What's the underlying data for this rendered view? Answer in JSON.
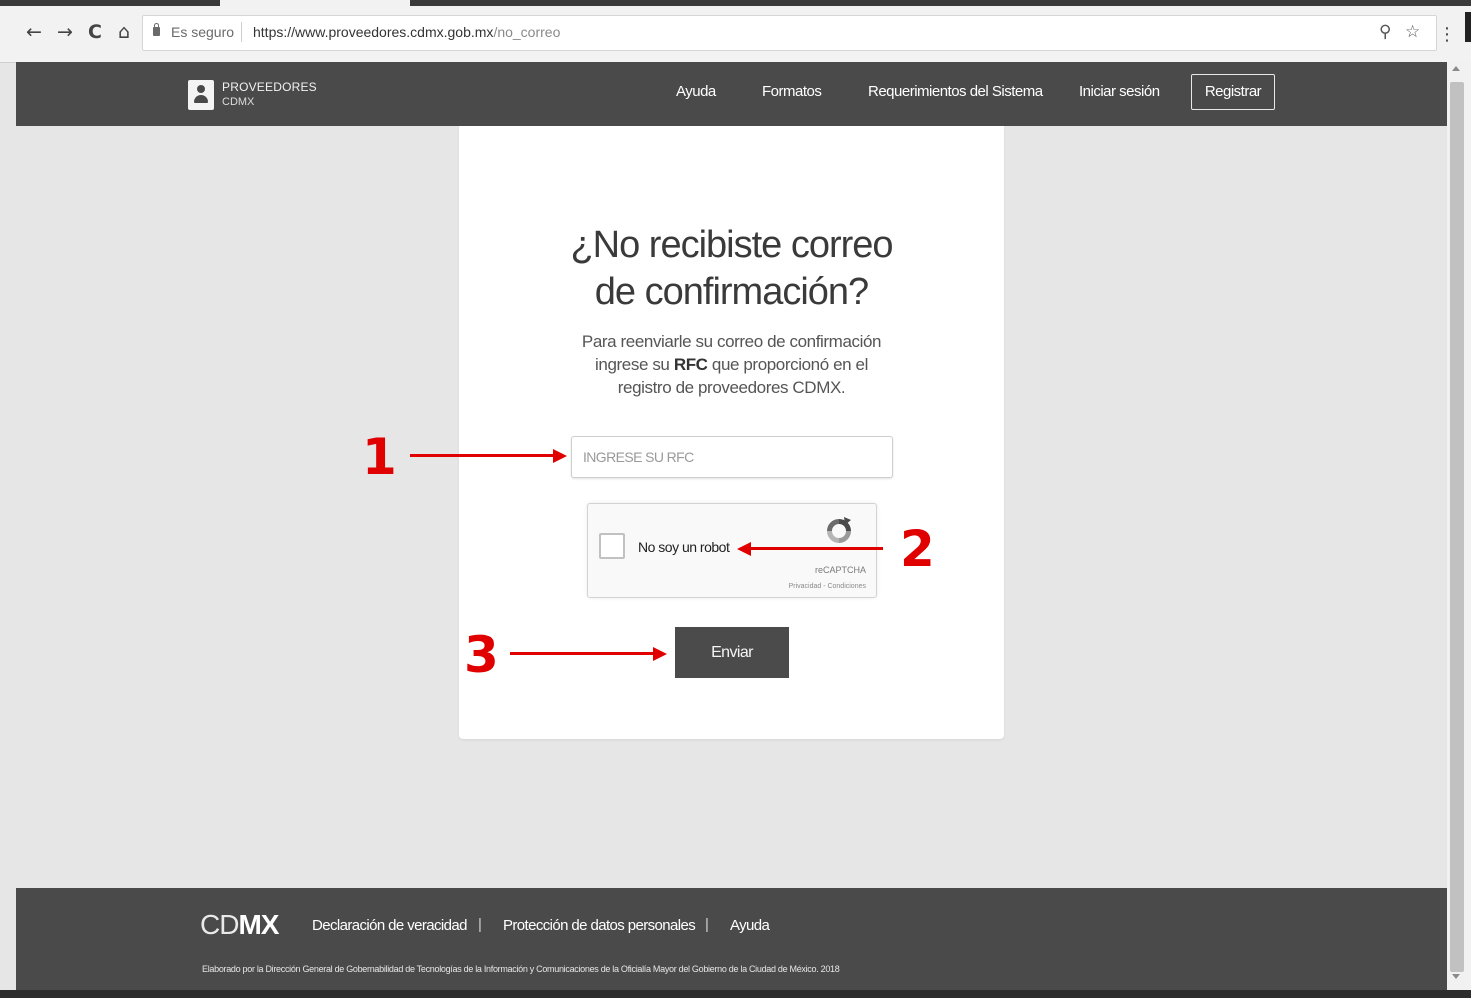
{
  "browser": {
    "nav": {
      "back_icon": "←",
      "forward_icon": "→",
      "reload_icon": "C",
      "home_icon": "⌂"
    },
    "secure_label": "Es seguro",
    "url_host": "https://www.proveedores.cdmx.gob.mx",
    "url_path": "/no_correo",
    "zoom_icon": "⚲",
    "star_icon": "☆",
    "menu_icon": "⋮"
  },
  "header": {
    "logo_line1": "PROVEEDORES",
    "logo_line2": "CDMX",
    "nav": [
      {
        "label": "Ayuda"
      },
      {
        "label": "Formatos"
      },
      {
        "label": "Requerimientos del Sistema"
      },
      {
        "label": "Iniciar sesión"
      }
    ],
    "register_label": "Registrar"
  },
  "form": {
    "title_line1": "¿No recibiste correo",
    "title_line2": "de confirmación?",
    "desc_line1": "Para reenviarle su correo de confirmación",
    "desc_line2_pre": "ingrese su ",
    "desc_line2_bold": "RFC",
    "desc_line2_post": " que proporcionó en el",
    "desc_line3": "registro de proveedores CDMX.",
    "rfc_placeholder": "INGRESE SU RFC",
    "rfc_value": "",
    "captcha_label": "No soy un robot",
    "captcha_brand": "reCAPTCHA",
    "captcha_terms": "Privacidad - Condiciones",
    "captcha_checked": false,
    "submit_label": "Enviar"
  },
  "annotations": [
    {
      "label": "1"
    },
    {
      "label": "2"
    },
    {
      "label": "3"
    }
  ],
  "footer": {
    "logo_light": "CD",
    "logo_bold": "MX",
    "links": [
      {
        "label": "Declaración de veracidad"
      },
      {
        "label": "Protección de datos personales"
      },
      {
        "label": "Ayuda"
      }
    ],
    "separator": "|",
    "note": "Elaborado por la Dirección General de Gobernabilidad de Tecnologías de la Información y Comunicaciones de la Oficialía Mayor del Gobierno de la Ciudad de México. 2018"
  },
  "colors": {
    "header_bg": "#4a4a4a",
    "page_bg": "#e6e6e6",
    "annotation": "#e00000",
    "button_bg": "#4b4b4b"
  }
}
